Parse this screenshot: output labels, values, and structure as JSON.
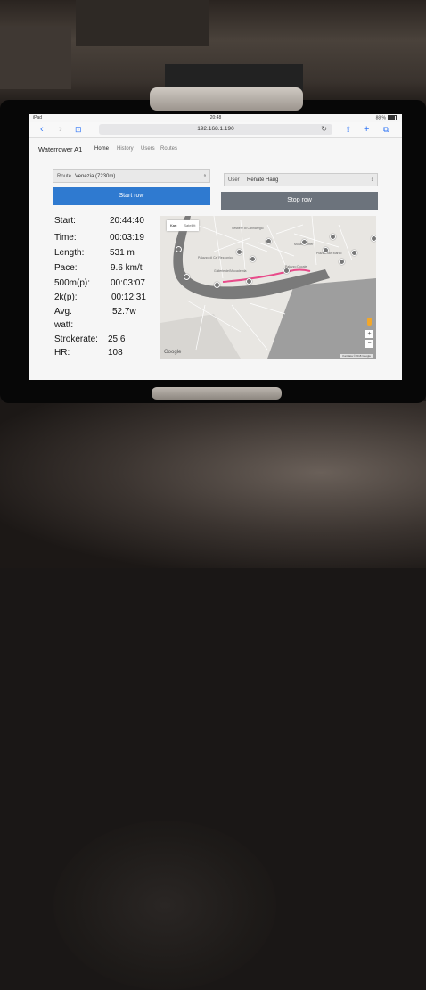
{
  "status_bar": {
    "device": "iPad",
    "time": "20:48",
    "battery": "88 %"
  },
  "browser": {
    "url": "192.168.1.190"
  },
  "nav": {
    "brand": "Waterrower A1",
    "links": [
      "Home",
      "History",
      "Users",
      "Routes"
    ]
  },
  "route_select": {
    "label": "Route",
    "value": "Venezia (7230m)"
  },
  "user_select": {
    "label": "User",
    "value": "Renate Haug"
  },
  "buttons": {
    "start": "Start row",
    "stop": "Stop row"
  },
  "stats": [
    {
      "label": "Start:",
      "value": "20:44:40"
    },
    {
      "label": "Time:",
      "value": "00:03:19"
    },
    {
      "label": "Length:",
      "value": "531 m"
    },
    {
      "label": "Pace:",
      "value": "9.6 km/t"
    },
    {
      "label": "500m(p):",
      "value": "00:03:07"
    },
    {
      "label": "2k(p):",
      "value": "00:12:31"
    },
    {
      "label": "Avg.",
      "value": "52.7w"
    },
    {
      "label": "watt:",
      "value": ""
    },
    {
      "label": "Strokerate:",
      "value": "25.6"
    },
    {
      "label": "HR:",
      "value": "108"
    }
  ],
  "map": {
    "type_buttons": [
      "Kart",
      "Satellitt"
    ],
    "logo": "Google",
    "attribution": "Kartdata ©2018 Google",
    "zoom_in": "+",
    "zoom_out": "−",
    "places": [
      "Sestiere di Cannaregio",
      "Palazzo di Ca' Rezzonico",
      "Museo Correr",
      "Gallerie dell'Accademia",
      "Piazza San Marco",
      "Palazzo Ducale"
    ]
  },
  "colors": {
    "start_button": "#2f7ad0",
    "stop_button": "#6c737c",
    "route_line": "#e84b8a"
  }
}
